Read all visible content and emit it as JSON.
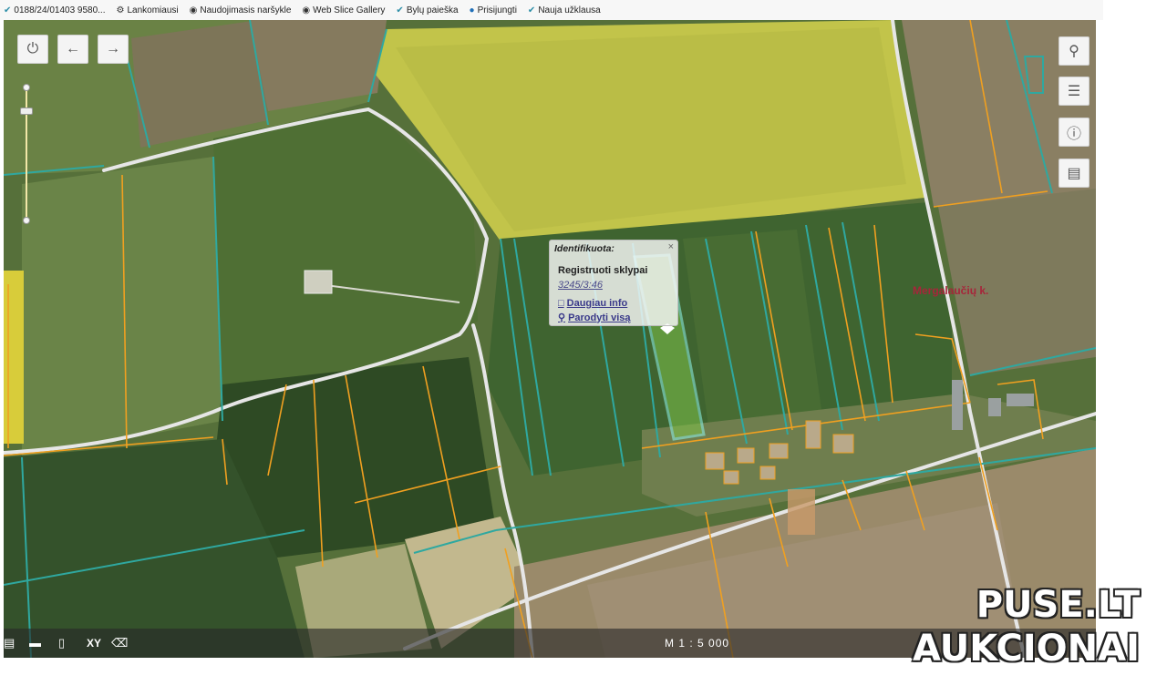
{
  "favorites": [
    {
      "icon": "leaf-icon",
      "label": "0188/24/01403  9580..."
    },
    {
      "icon": "gear-icon",
      "label": "Lankomiausi"
    },
    {
      "icon": "globe-icon",
      "label": "Naudojimasis naršykle"
    },
    {
      "icon": "globe-icon",
      "label": "Web Slice Gallery"
    },
    {
      "icon": "leaf-icon",
      "label": "Bylų paieška"
    },
    {
      "icon": "c-logo-icon",
      "label": "Prisijungti"
    },
    {
      "icon": "leaf-icon",
      "label": "Nauja užklausa"
    }
  ],
  "map": {
    "popup": {
      "title": "Identifikuota:",
      "close": "×",
      "layer": "Registruoti sklypai",
      "parcel_id": "3245/3:46",
      "more_info": "Daugiau info",
      "show_all": "Parodyti visą"
    },
    "village_label": "Mergalaučių k.",
    "tools": {
      "xy": "XY"
    },
    "scale": "M 1 : 5 000",
    "colors": {
      "parcel_border": "#2fa8a0",
      "selected_parcel": "#7ff0e8",
      "cadastral_line": "#f0a020",
      "road": "#e8e8e8"
    }
  },
  "watermark": {
    "line1": "PUSE.LT",
    "line2": "AUKCIONAI"
  }
}
